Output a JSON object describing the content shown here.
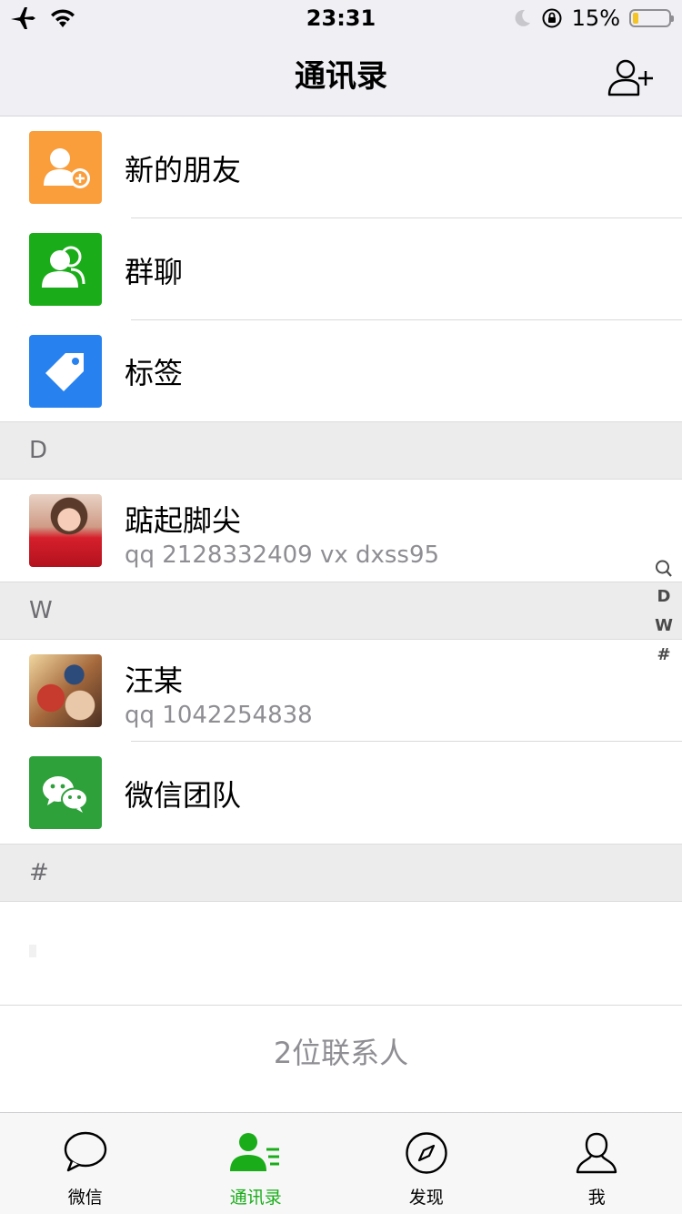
{
  "status_bar": {
    "time": "23:31",
    "battery_percent": "15%",
    "battery_level": 0.15,
    "icons": [
      "airplane-icon",
      "wifi-icon",
      "moon-icon",
      "rotation-lock-icon",
      "battery-icon"
    ]
  },
  "nav": {
    "title": "通讯录",
    "add_icon": "add-contact-icon"
  },
  "top_items": [
    {
      "label": "新的朋友",
      "icon": "new-friends-icon",
      "color": "#fa9d3b"
    },
    {
      "label": "群聊",
      "icon": "group-chat-icon",
      "color": "#1aad19"
    },
    {
      "label": "标签",
      "icon": "tag-icon",
      "color": "#2782f0"
    }
  ],
  "sections": [
    {
      "letter": "D",
      "contacts": [
        {
          "name": "踮起脚尖",
          "subtitle": "qq 2128332409 vx dxss95"
        }
      ]
    },
    {
      "letter": "W",
      "contacts": [
        {
          "name": "汪某",
          "subtitle": "qq 1042254838"
        },
        {
          "name": "微信团队",
          "subtitle": ""
        }
      ]
    },
    {
      "letter": "#",
      "contacts": []
    }
  ],
  "index_bar": [
    "D",
    "W",
    "#"
  ],
  "contact_count": "2位联系人",
  "tabs": [
    {
      "label": "微信",
      "icon": "chat-bubble-icon",
      "active": false
    },
    {
      "label": "通讯录",
      "icon": "contacts-icon",
      "active": true
    },
    {
      "label": "发现",
      "icon": "compass-icon",
      "active": false
    },
    {
      "label": "我",
      "icon": "person-icon",
      "active": false
    }
  ],
  "colors": {
    "accent": "#1aad19",
    "header_bg": "#efeff4",
    "section_bg": "#ececec"
  }
}
